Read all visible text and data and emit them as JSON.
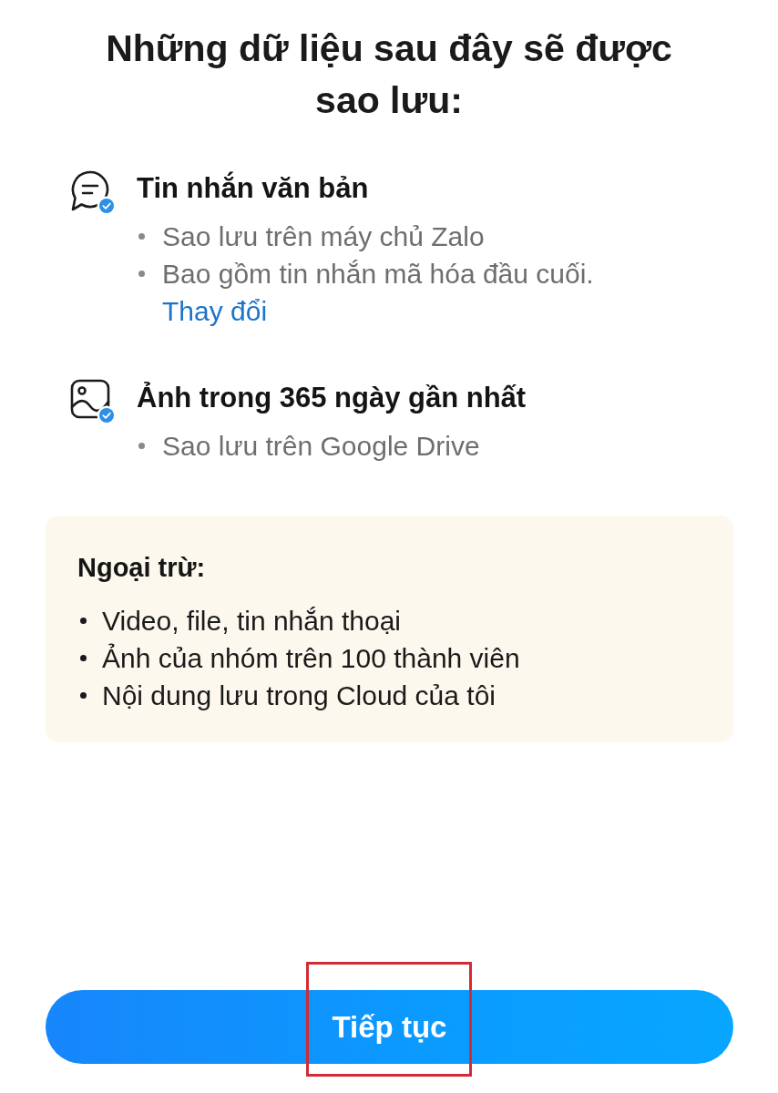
{
  "title": "Những dữ liệu sau đây sẽ được sao lưu:",
  "categories": [
    {
      "kind": "messages",
      "title": "Tin nhắn văn bản",
      "checked": true,
      "details": [
        "Sao lưu trên máy chủ Zalo",
        "Bao gồm tin nhắn mã hóa đầu cuối."
      ],
      "link": "Thay đổi"
    },
    {
      "kind": "photos",
      "title": "Ảnh trong 365 ngày gần nhất",
      "checked": true,
      "details": [
        "Sao lưu trên Google Drive"
      ]
    }
  ],
  "exclusions": {
    "title": "Ngoại trừ:",
    "items": [
      "Video, file, tin nhắn thoại",
      "Ảnh của nhóm trên 100 thành viên",
      "Nội dung lưu trong Cloud của tôi"
    ]
  },
  "continue_button": {
    "label": "Tiếp tục",
    "highlighted": true
  }
}
